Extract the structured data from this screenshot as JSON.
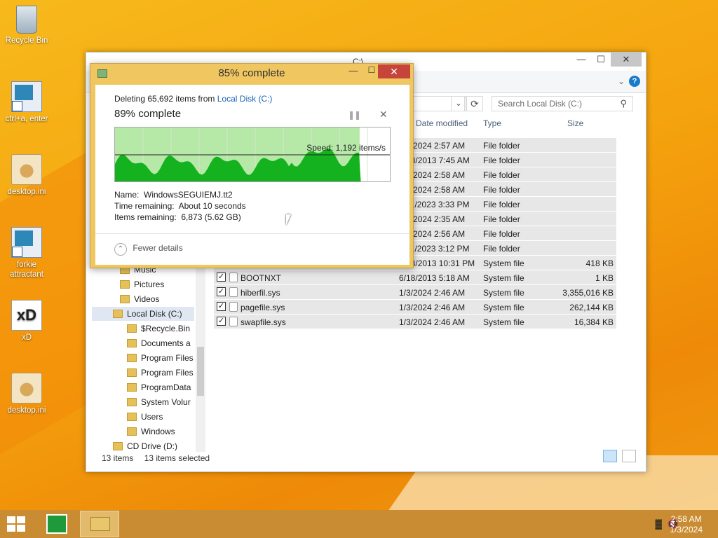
{
  "desktop": {
    "icons": [
      {
        "label": "Recycle Bin",
        "icon": "recycle-bin-icon"
      },
      {
        "label": "ctrl+a, enter",
        "icon": "shortcut-icon"
      },
      {
        "label": "desktop.ini",
        "icon": "settings-file-icon"
      },
      {
        "label": "forkie attractant",
        "icon": "shortcut-icon"
      },
      {
        "label": "xD",
        "icon": "xd-shortcut-icon"
      },
      {
        "label": "desktop.ini",
        "icon": "settings-file-icon"
      }
    ]
  },
  "explorer": {
    "title": "C:\\",
    "search_placeholder": "Search Local Disk (C:)",
    "columns": {
      "date": "Date modified",
      "type": "Type",
      "size": "Size"
    },
    "rows": [
      {
        "name": "",
        "date": "1/3/2024 2:57 AM",
        "type": "File folder",
        "size": ""
      },
      {
        "name": "",
        "date": "6/18/2013 7:45 AM",
        "type": "File folder",
        "size": ""
      },
      {
        "name": "",
        "date": "1/3/2024 2:58 AM",
        "type": "File folder",
        "size": ""
      },
      {
        "name": "",
        "date": "1/3/2024 2:58 AM",
        "type": "File folder",
        "size": ""
      },
      {
        "name": "",
        "date": "11/1/2023 3:33 PM",
        "type": "File folder",
        "size": ""
      },
      {
        "name": "",
        "date": "1/3/2024 2:35 AM",
        "type": "File folder",
        "size": ""
      },
      {
        "name": "",
        "date": "1/3/2024 2:56 AM",
        "type": "File folder",
        "size": ""
      },
      {
        "name": "",
        "date": "11/1/2023 3:12 PM",
        "type": "File folder",
        "size": ""
      },
      {
        "name": "",
        "date": "6/18/2013 10:31 PM",
        "type": "System file",
        "size": "418 KB"
      },
      {
        "name": "BOOTNXT",
        "date": "6/18/2013 5:18 AM",
        "type": "System file",
        "size": "1 KB"
      },
      {
        "name": "hiberfil.sys",
        "date": "1/3/2024 2:46 AM",
        "type": "System file",
        "size": "3,355,016 KB"
      },
      {
        "name": "pagefile.sys",
        "date": "1/3/2024 2:46 AM",
        "type": "System file",
        "size": "262,144 KB"
      },
      {
        "name": "swapfile.sys",
        "date": "1/3/2024 2:46 AM",
        "type": "System file",
        "size": "16,384 KB"
      }
    ],
    "nav": [
      {
        "label": "Music",
        "indent": 1
      },
      {
        "label": "Pictures",
        "indent": 1
      },
      {
        "label": "Videos",
        "indent": 1
      },
      {
        "label": "Local Disk (C:)",
        "indent": 0,
        "selected": true
      },
      {
        "label": "$Recycle.Bin",
        "indent": 2
      },
      {
        "label": "Documents a",
        "indent": 2
      },
      {
        "label": "Program Files",
        "indent": 2
      },
      {
        "label": "Program Files",
        "indent": 2
      },
      {
        "label": "ProgramData",
        "indent": 2
      },
      {
        "label": "System Volur",
        "indent": 2
      },
      {
        "label": "Users",
        "indent": 2
      },
      {
        "label": "Windows",
        "indent": 2
      },
      {
        "label": "CD Drive (D:)",
        "indent": 0
      }
    ],
    "status_items": "13 items",
    "status_selected": "13 items selected"
  },
  "dialog": {
    "title": "85% complete",
    "deleting_prefix": "Deleting 65,692 items from",
    "deleting_link": "Local Disk (C:)",
    "percent": "89% complete",
    "speed": "Speed: 1,192 items/s",
    "name_label": "Name:",
    "name_value": "WindowsSEGUIEMJ.tt2",
    "time_label": "Time remaining:",
    "time_value": "About 10 seconds",
    "items_label": "Items remaining:",
    "items_value": "6,873 (5.62 GB)",
    "fewer_details": "Fewer details",
    "progress_fraction": 0.89
  },
  "taskbar": {
    "time": "2:58 AM",
    "date": "1/3/2024"
  },
  "colors": {
    "dialog_accent": "#f0c660",
    "graph_fill": "#14b21e",
    "graph_bg": "#b6e8a7",
    "link": "#1a63b5"
  }
}
